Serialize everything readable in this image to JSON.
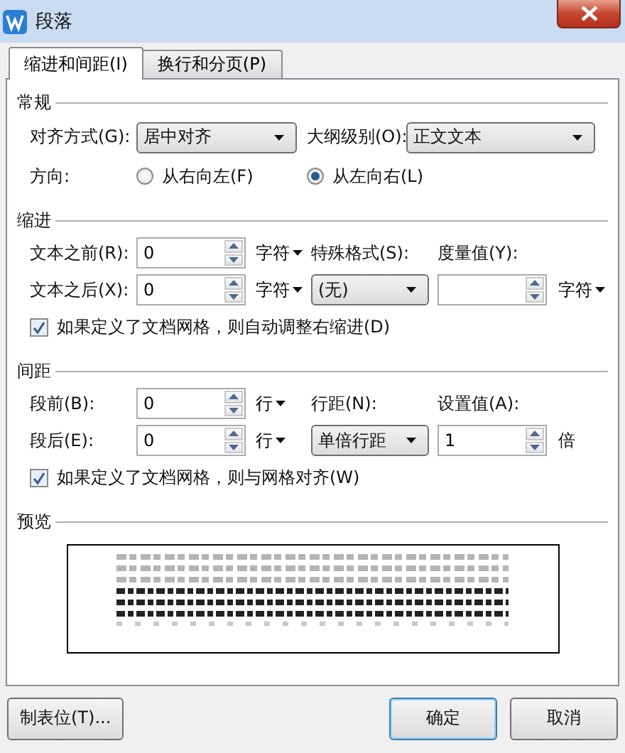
{
  "window": {
    "title": "段落"
  },
  "tabs": [
    {
      "label": "缩进和间距(I)",
      "selected": true
    },
    {
      "label": "换行和分页(P)",
      "selected": false
    }
  ],
  "general": {
    "title": "常规",
    "alignment": {
      "label": "对齐方式(G):",
      "value": "居中对齐"
    },
    "outline_level": {
      "label": "大纲级别(O):",
      "value": "正文文本"
    },
    "direction": {
      "label": "方向:",
      "options": [
        {
          "label": "从右向左(F)",
          "selected": false
        },
        {
          "label": "从左向右(L)",
          "selected": true
        }
      ]
    }
  },
  "indent": {
    "title": "缩进",
    "before": {
      "label": "文本之前(R):",
      "value": "0",
      "unit": "字符",
      "has_menu": true
    },
    "after": {
      "label": "文本之后(X):",
      "value": "0",
      "unit": "字符",
      "has_menu": true
    },
    "special": {
      "label": "特殊格式(S):",
      "value": "(无)"
    },
    "measure": {
      "label": "度量值(Y):",
      "unit": "字符",
      "has_menu": true
    },
    "grid_option": {
      "label": "如果定义了文档网格，则自动调整右缩进(D)",
      "checked": true
    }
  },
  "spacing": {
    "title": "间距",
    "before": {
      "label": "段前(B):",
      "value": "0",
      "unit": "行",
      "has_menu": true
    },
    "after": {
      "label": "段后(E):",
      "value": "0",
      "unit": "行",
      "has_menu": true
    },
    "special": {
      "label": "行距(N):",
      "value": "单倍行距"
    },
    "measure": {
      "label": "设置值(A):",
      "value": "1",
      "unit": "倍",
      "has_menu": false
    },
    "grid_option": {
      "label": "如果定义了文档网格，则与网格对齐(W)",
      "checked": true
    }
  },
  "preview": {
    "title": "预览"
  },
  "buttons": [
    {
      "label": "制表位(T)...",
      "default": false
    },
    {
      "label": "确定",
      "default": true
    },
    {
      "label": "取消",
      "default": false
    }
  ]
}
